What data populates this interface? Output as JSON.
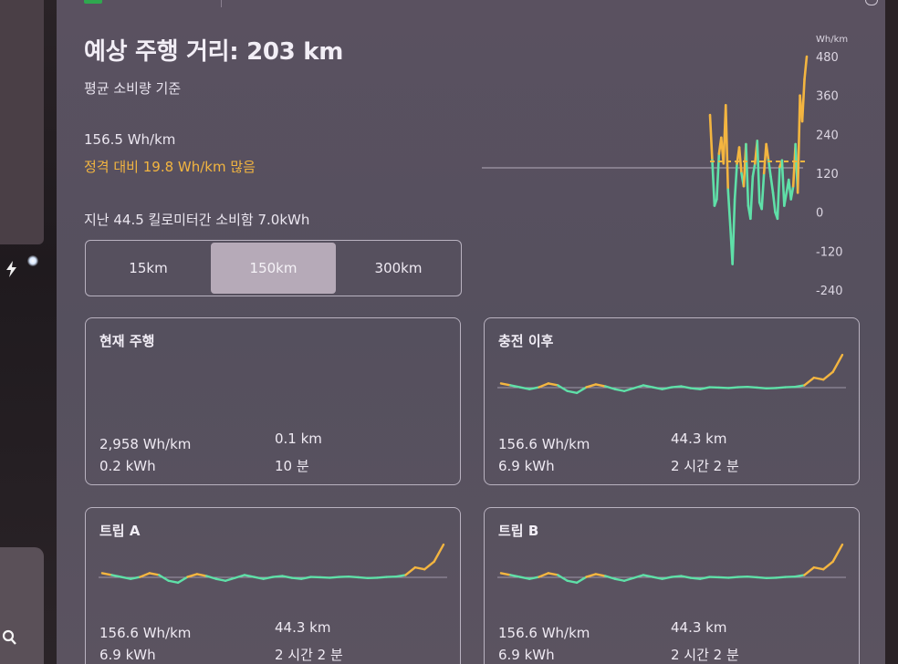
{
  "header": {
    "title": "예상 주행 거리: 203 km",
    "subtitle": "평균 소비량 기준"
  },
  "consumption": {
    "average": "156.5 Wh/km",
    "difference": "정격 대비 19.8 Wh/km 많음",
    "recent_usage": "지난 44.5 킬로미터간 소비함 7.0kWh"
  },
  "distance_selector": {
    "options": [
      "15km",
      "150km",
      "300km"
    ],
    "selected": "150km"
  },
  "chart_data": {
    "type": "line",
    "ylabel": "Wh/km",
    "y_ticks": [
      "480",
      "360",
      "240",
      "120",
      "0",
      "-120",
      "-240"
    ],
    "ylim": [
      -240,
      480
    ],
    "rated_line": 137,
    "average_line": 156.5,
    "series": [
      {
        "values": [
          300,
          160,
          20,
          40,
          180,
          230,
          150,
          330,
          70,
          -40,
          -160,
          40,
          150,
          200,
          120,
          80,
          210,
          20,
          -20,
          110,
          150,
          220,
          30,
          10,
          120,
          210,
          160,
          110,
          60,
          0,
          -20,
          140,
          160,
          20,
          60,
          100,
          40,
          80,
          210,
          60,
          360,
          280,
          410,
          480
        ]
      }
    ]
  },
  "cards": [
    {
      "title": "현재 주행",
      "efficiency": "2,958 Wh/km",
      "energy": "0.2 kWh",
      "distance": "0.1 km",
      "duration": "10 분",
      "has_chart": false
    },
    {
      "title": "충전 이후",
      "efficiency": "156.6 Wh/km",
      "energy": "6.9 kWh",
      "distance": "44.3 km",
      "duration": "2 시간 2 분",
      "has_chart": true
    },
    {
      "title": "트립 A",
      "efficiency": "156.6 Wh/km",
      "energy": "6.9 kWh",
      "distance": "44.3 km",
      "duration": "2 시간 2 분",
      "has_chart": true
    },
    {
      "title": "트립 B",
      "efficiency": "156.6 Wh/km",
      "energy": "6.9 kWh",
      "distance": "44.3 km",
      "duration": "2 시간 2 분",
      "has_chart": true
    }
  ],
  "mini_chart_data": {
    "values": [
      170,
      160,
      150,
      140,
      150,
      170,
      160,
      130,
      120,
      150,
      165,
      155,
      140,
      130,
      145,
      160,
      150,
      140,
      150,
      155,
      145,
      140,
      150,
      148,
      146,
      150,
      152,
      148,
      144,
      146,
      150,
      152,
      160,
      200,
      190,
      230,
      320
    ]
  },
  "colors": {
    "above": "#f3b540",
    "below": "#5fe0a8",
    "accent_text": "#f3b540"
  }
}
